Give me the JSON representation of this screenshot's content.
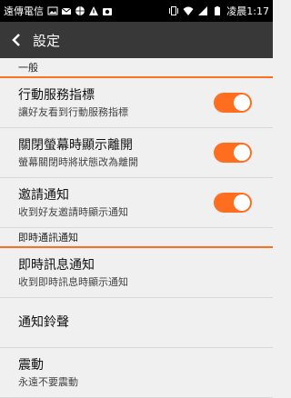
{
  "status_bar": {
    "carrier": "遠傳電信",
    "time": "凌晨1:17",
    "icons": [
      "image-icon",
      "mail-icon",
      "globe-icon",
      "warning-icon",
      "camera-icon",
      "vibrate-icon",
      "wifi-icon",
      "signal-icon",
      "battery-icon"
    ]
  },
  "app_bar": {
    "back_icon": "chevron-left-icon",
    "title": "設定"
  },
  "sections": [
    {
      "header": "一般",
      "items": [
        {
          "title": "行動服務指標",
          "subtitle": "讓好友看到行動服務指標",
          "toggle": true
        },
        {
          "title": "關閉螢幕時顯示離開",
          "subtitle": "螢幕關閉時將狀態改為離開",
          "toggle": true
        },
        {
          "title": "邀請通知",
          "subtitle": "收到好友邀請時顯示通知",
          "toggle": true
        }
      ]
    },
    {
      "header": "即時通訊通知",
      "items": [
        {
          "title": "即時訊息通知",
          "subtitle": "收到即時訊息時顯示通知"
        },
        {
          "title": "通知鈴聲"
        },
        {
          "title": "震動",
          "subtitle": "永遠不要震動"
        }
      ]
    }
  ],
  "colors": {
    "accent": "#ff6d1f",
    "appbar": "#383838",
    "background": "#f0f0f0"
  }
}
